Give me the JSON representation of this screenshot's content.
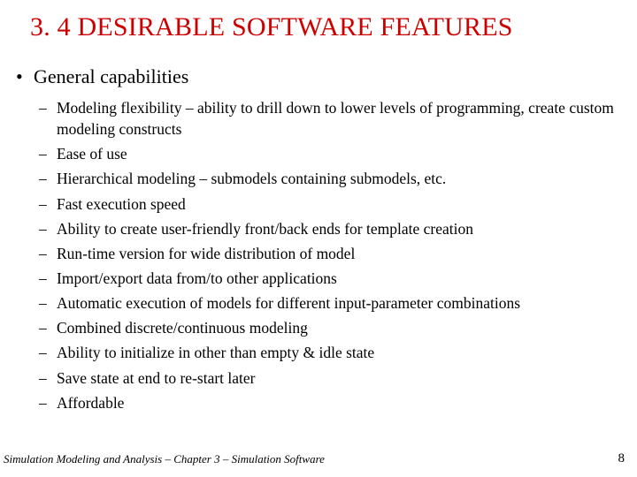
{
  "title": "3. 4  DESIRABLE SOFTWARE FEATURES",
  "bullets": {
    "lvl1": "General capabilities",
    "items": [
      "Modeling flexibility – ability to drill down to lower levels of programming, create custom modeling constructs",
      "Ease of use",
      "Hierarchical modeling – submodels containing submodels, etc.",
      "Fast execution speed",
      "Ability to create user-friendly front/back ends for template creation",
      "Run-time version for wide distribution of model",
      "Import/export data from/to other applications",
      "Automatic execution of models for different input-parameter combinations",
      "Combined discrete/continuous modeling",
      "Ability to initialize in other than empty & idle state",
      "Save state at end to re-start later",
      "Affordable"
    ]
  },
  "footer": "Simulation Modeling and Analysis – Chapter 3 – Simulation Software",
  "page": "8"
}
